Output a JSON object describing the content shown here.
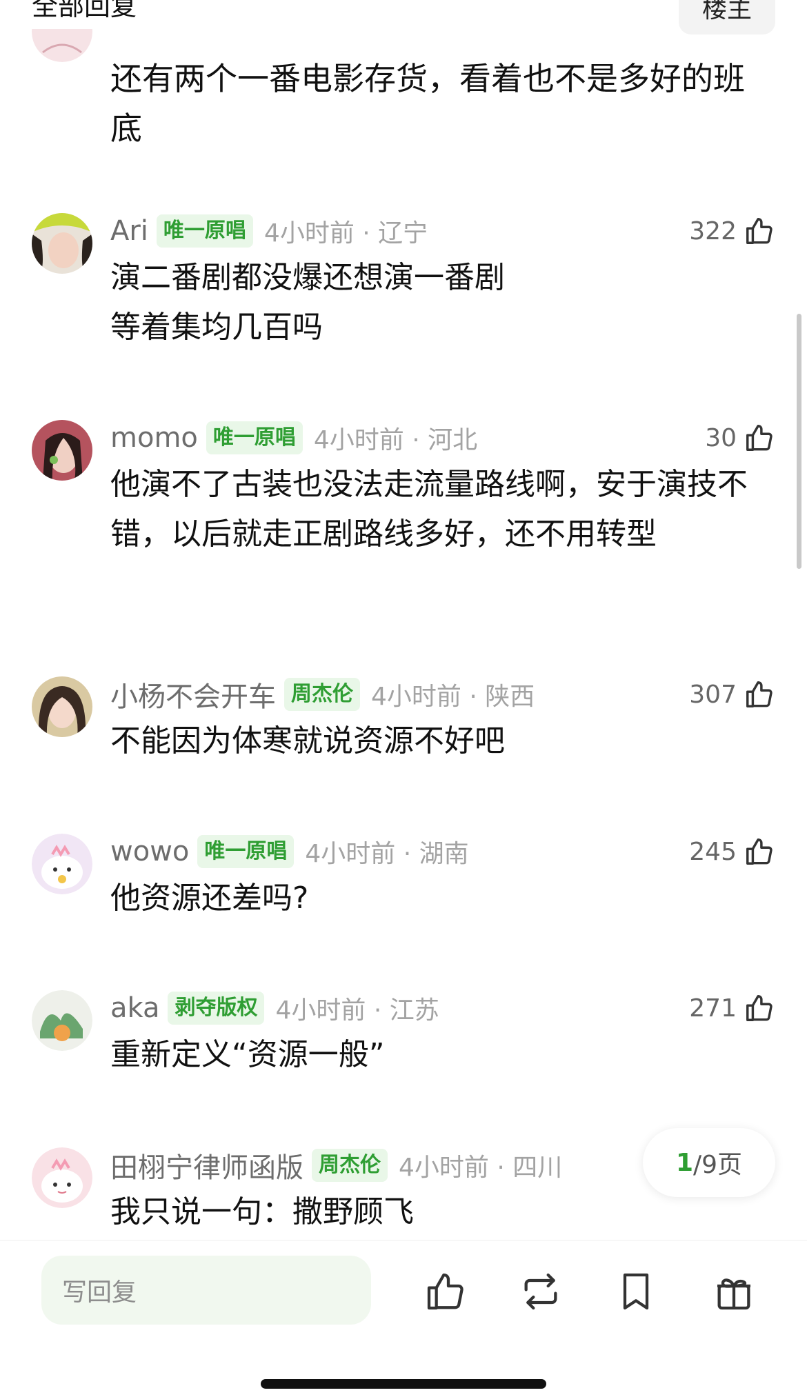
{
  "header": {
    "title": "全部回复",
    "owner_label": "楼主"
  },
  "first_comment": {
    "text": "还有两个一番电影存货，看着也不是多好的班底"
  },
  "comments": [
    {
      "name": "Ari",
      "badge": "唯一原唱",
      "time": "4小时前 · 辽宁",
      "likes": "322",
      "text": "演二番剧都没爆还想演一番剧\n等着集均几百吗"
    },
    {
      "name": "momo",
      "badge": "唯一原唱",
      "time": "4小时前 · 河北",
      "likes": "30",
      "text": "他演不了古装也没法走流量路线啊，安于演技不错，以后就走正剧路线多好，还不用转型"
    },
    {
      "name": "小杨不会开车",
      "badge": "周杰伦",
      "time": "4小时前 · 陕西",
      "likes": "307",
      "text": "不能因为体寒就说资源不好吧"
    },
    {
      "name": "wowo",
      "badge": "唯一原唱",
      "time": "4小时前 · 湖南",
      "likes": "245",
      "text": "他资源还差吗?"
    },
    {
      "name": "aka",
      "badge": "剥夺版权",
      "time": "4小时前 · 江苏",
      "likes": "271",
      "text": "重新定义“资源一般”"
    },
    {
      "name": "田栩宁律师函版",
      "badge": "周杰伦",
      "time": "4小时前 · 四川",
      "likes": "",
      "text": "我只说一句：撒野顾飞"
    }
  ],
  "pager": {
    "current": "1",
    "total_text": "/9页"
  },
  "bottom_bar": {
    "reply_placeholder": "写回复",
    "icons": [
      "like-icon",
      "repost-icon",
      "bookmark-icon",
      "gift-icon"
    ]
  },
  "colors": {
    "accent_green": "#2f9e33",
    "badge_bg": "#e9f7e8",
    "input_bg": "#f1f8ef"
  }
}
